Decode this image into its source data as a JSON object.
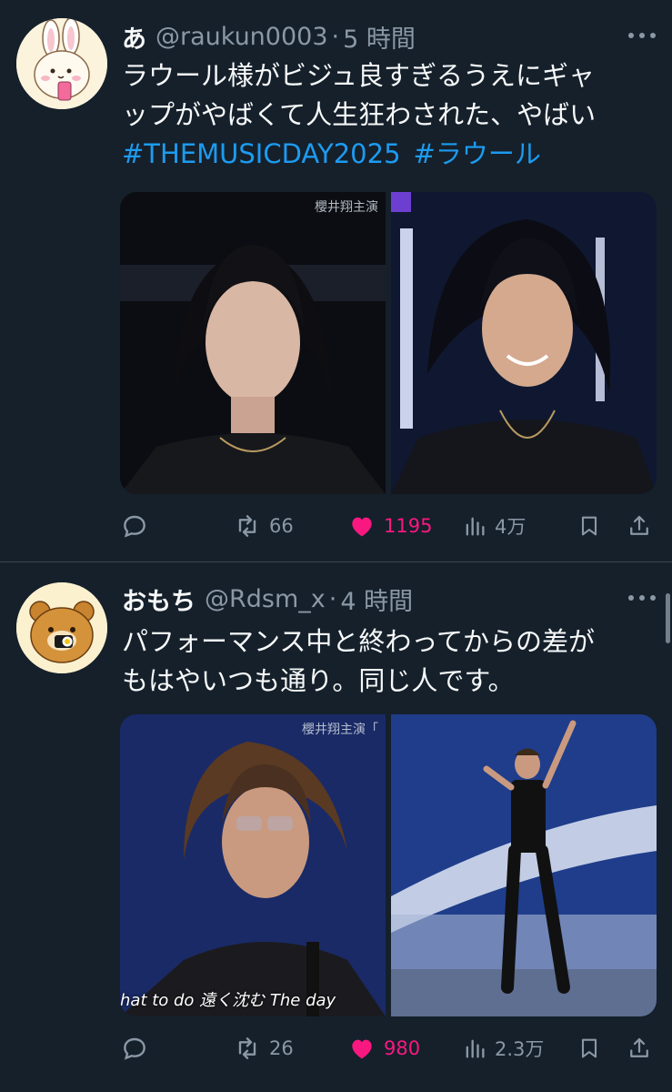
{
  "tweets": [
    {
      "name": "あ",
      "handle": "@raukun0003",
      "separator": "·",
      "time": "5 時間",
      "text_lines": [
        "ラウール様がビジュ良すぎるうえにギャ",
        "ップがやばくて人生狂わされた、やばい"
      ],
      "hashtags": [
        "#THEMUSICDAY2025",
        "#ラウール"
      ],
      "media_overlay": "櫻井翔主演",
      "stats": {
        "retweets": "66",
        "likes": "1195",
        "views": "4万"
      }
    },
    {
      "name": "おもち",
      "handle": "@Rdsm_x",
      "separator": "·",
      "time": "4 時間",
      "text_lines": [
        "パフォーマンス中と終わってからの差が",
        "もはやいつも通り。同じ人です。"
      ],
      "media_overlay": "櫻井翔主演「",
      "media_caption": "hat to do   遠く沈む  The day",
      "stats": {
        "retweets": "26",
        "likes": "980",
        "views": "2.3万"
      }
    }
  ],
  "colors": {
    "background": "#15202b",
    "divider": "#38444d",
    "secondary_text": "#8b98a5",
    "hashtag": "#1d9bf0",
    "like": "#f91880"
  },
  "icons": [
    "reply-icon",
    "retweet-icon",
    "heart-icon",
    "views-icon",
    "bookmark-icon",
    "share-icon",
    "more-icon"
  ]
}
